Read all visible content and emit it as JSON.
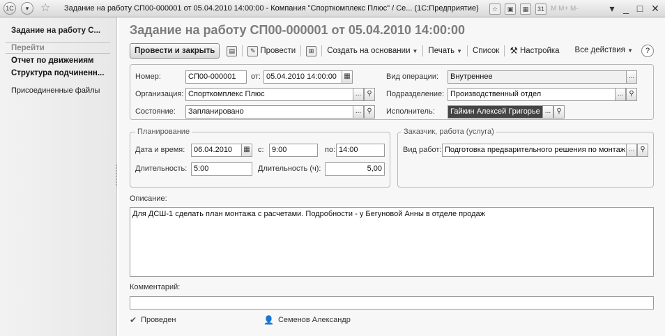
{
  "window": {
    "title": "Задание на работу СП00-000001 от 05.04.2010 14:00:00 - Компания \"Спорткомплекс Плюс\" / Се... (1С:Предприятие)",
    "logo": "1С",
    "toolbar_small": "M  M+  M-"
  },
  "sidebar": {
    "title": "Задание на работу С...",
    "goto_label": "Перейти",
    "links": [
      "Отчет по движениям",
      "Структура подчиненн..."
    ],
    "attached_files": "Присоединенные файлы"
  },
  "document": {
    "title": "Задание на работу СП00-000001 от 05.04.2010 14:00:00"
  },
  "toolbar": {
    "post_close": "Провести и закрыть",
    "post": "Провести",
    "create_based": "Создать на основании",
    "print": "Печать",
    "list": "Список",
    "settings": "Настройка",
    "all_actions": "Все действия",
    "help": "?"
  },
  "fields": {
    "number_label": "Номер:",
    "number": "СП00-000001",
    "from_label": "от:",
    "date": "05.04.2010 14:00:00",
    "operation_label": "Вид операции:",
    "operation": "Внутреннее",
    "org_label": "Организация:",
    "org": "Спорткомплекс Плюс",
    "dept_label": "Подразделение:",
    "dept": "Производственный отдел",
    "state_label": "Состояние:",
    "state": "Запланировано",
    "executor_label": "Исполнитель:",
    "executor": "Гайкин Алексей Григорье"
  },
  "planning": {
    "group_title": "Планирование",
    "datetime_label": "Дата и время:",
    "date": "06.04.2010",
    "from_label": "с:",
    "from": "9:00",
    "to_label": "по:",
    "to": "14:00",
    "duration_label": "Длительность:",
    "duration": "5:00",
    "duration_h_label": "Длительность (ч):",
    "duration_h": "5,00"
  },
  "customer": {
    "group_title": "Заказчик, работа (услуга)",
    "work_type_label": "Вид работ:",
    "work_type": "Подготовка предварительного решения по монтаж"
  },
  "description": {
    "label": "Описание:",
    "text": "Для ДСШ-1 сделать план монтажа с расчетами. Подробности - у Бегуновой Анны в отделе продаж"
  },
  "comment": {
    "label": "Комментарий:",
    "text": ""
  },
  "footer": {
    "status": "Проведен",
    "user": "Семенов Александр"
  }
}
